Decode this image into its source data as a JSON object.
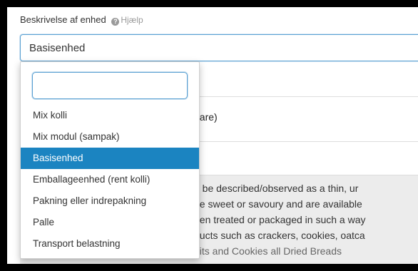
{
  "field": {
    "label": "Beskrivelse af enhed",
    "help_label": "Hjælp",
    "selected_value": "Basisenhed"
  },
  "dropdown": {
    "search_value": "",
    "options": [
      {
        "label": "Mix kolli",
        "selected": false
      },
      {
        "label": "Mix modul (sampak)",
        "selected": false
      },
      {
        "label": "Basisenhed",
        "selected": true
      },
      {
        "label": "Emballageenhed (rent kolli)",
        "selected": false
      },
      {
        "label": "Pakning eller indrepakning",
        "selected": false
      },
      {
        "label": "Palle",
        "selected": false
      },
      {
        "label": "Transport belastning",
        "selected": false
      }
    ]
  },
  "background": {
    "row_text": "pare)",
    "description_lines": [
      "n be described/observed as a thin, ur",
      " be sweet or savoury and are available",
      "een treated or packaged in such a way",
      "ducts such as crackers, cookies, oatca",
      "uits and Cookies  all Dried Breads"
    ]
  },
  "colors": {
    "accent": "#1b84c1",
    "focus_border": "#5aa0d2"
  }
}
